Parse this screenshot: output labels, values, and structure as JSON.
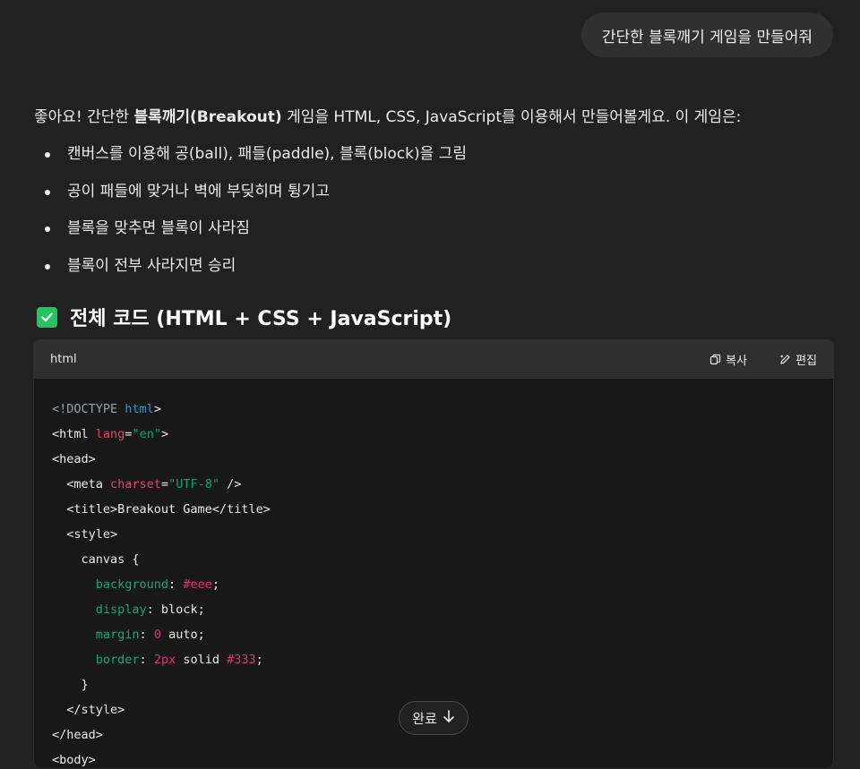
{
  "user_message": "간단한 블록깨기 게임을 만들어줘",
  "intro": {
    "prefix": "좋아요! 간단한 ",
    "bold": "블록깨기(Breakout)",
    "suffix": " 게임을 HTML, CSS, JavaScript를 이용해서 만들어볼게요. 이 게임은:"
  },
  "bullets": [
    "캔버스를 이용해 공(ball), 패들(paddle), 블록(block)을 그림",
    "공이 패들에 맞거나 벽에 부딪히며 튕기고",
    "블록을 맞추면 블록이 사라짐",
    "블록이 전부 사라지면 승리"
  ],
  "section_heading": "전체 코드 (HTML + CSS + JavaScript)",
  "code_block": {
    "language": "html",
    "copy_label": "복사",
    "edit_label": "편집",
    "lines": {
      "l1": "<!DOCTYPE",
      "l1b": "html",
      "l1c": ">",
      "l2a": "<html ",
      "l2b": "lang",
      "l2c": "=",
      "l2d": "\"en\"",
      "l2e": ">",
      "l3": "<head>",
      "l4a": "  <meta ",
      "l4b": "charset",
      "l4c": "=",
      "l4d": "\"UTF-8\"",
      "l4e": " />",
      "l5": "  <title>Breakout Game</title>",
      "l6": "  <style>",
      "l7": "    canvas {",
      "l8a": "      background",
      "l8b": ": ",
      "l8c": "#eee",
      "l8d": ";",
      "l9a": "      display",
      "l9b": ": block;",
      "l10a": "      margin",
      "l10b": ": ",
      "l10c": "0",
      "l10d": " auto;",
      "l11a": "      border",
      "l11b": ": ",
      "l11c": "2px",
      "l11d": " solid ",
      "l11e": "#333",
      "l11f": ";",
      "l12": "    }",
      "l13": "  </style>",
      "l14": "</head>",
      "l15": "<body>"
    }
  },
  "done_button_label": "완료",
  "colors": {
    "background": "#212121",
    "bubble": "#303030",
    "check": "#22c55e",
    "code_bg": "#181818",
    "code_header": "#2f2f2f"
  },
  "icons": [
    "check-icon",
    "copy-icon",
    "edit-icon",
    "arrow-down-icon"
  ]
}
